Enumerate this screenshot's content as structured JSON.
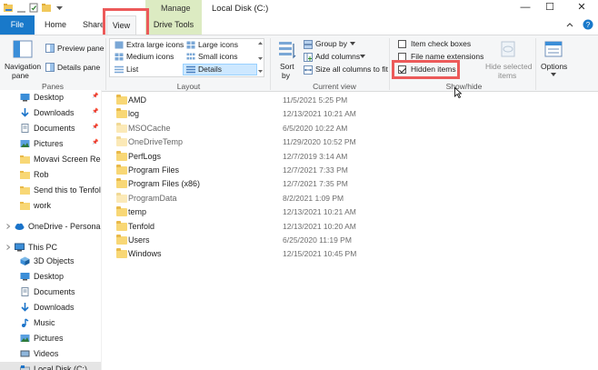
{
  "window": {
    "title": "Local Disk (C:)",
    "manage_tab": "Manage",
    "minimize": "—",
    "maximize": "☐",
    "close": "✕",
    "help": "?"
  },
  "tabs": {
    "file": "File",
    "home": "Home",
    "share": "Share",
    "view": "View",
    "drive_tools": "Drive Tools"
  },
  "ribbon": {
    "panes": {
      "navigation_pane": "Navigation",
      "navigation_pane_2": "pane",
      "preview_pane": "Preview pane",
      "details_pane": "Details pane",
      "group_label": "Panes"
    },
    "layout": {
      "extra_large_icons": "Extra large icons",
      "large_icons": "Large icons",
      "medium_icons": "Medium icons",
      "small_icons": "Small icons",
      "list": "List",
      "details": "Details",
      "group_label": "Layout"
    },
    "current_view": {
      "sort_by": "Sort",
      "sort_by_2": "by",
      "group_by": "Group by",
      "add_columns": "Add columns",
      "size_all_columns": "Size all columns to fit",
      "group_label": "Current view"
    },
    "show_hide": {
      "item_check_boxes": "Item check boxes",
      "file_name_extensions": "File name extensions",
      "hidden_items": "Hidden items",
      "hide_selected": "Hide selected",
      "hide_selected_2": "items",
      "group_label": "Show/hide",
      "item_check_boxes_checked": false,
      "file_name_extensions_checked": false,
      "hidden_items_checked": true
    },
    "options": {
      "label": "Options"
    }
  },
  "nav": {
    "items": [
      {
        "label": "Desktop",
        "pinned": true
      },
      {
        "label": "Downloads",
        "pinned": true
      },
      {
        "label": "Documents",
        "pinned": true
      },
      {
        "label": "Pictures",
        "pinned": true
      },
      {
        "label": "Movavi Screen Reco",
        "pinned": false
      },
      {
        "label": "Rob",
        "pinned": false
      },
      {
        "label": "Send this to Tenfold",
        "pinned": false
      },
      {
        "label": "work",
        "pinned": false
      },
      {
        "label": "OneDrive - Personal",
        "pinned": false
      },
      {
        "label": "This PC",
        "pinned": false
      },
      {
        "label": "3D Objects",
        "pinned": false
      },
      {
        "label": "Desktop",
        "pinned": false
      },
      {
        "label": "Documents",
        "pinned": false
      },
      {
        "label": "Downloads",
        "pinned": false
      },
      {
        "label": "Music",
        "pinned": false
      },
      {
        "label": "Pictures",
        "pinned": false
      },
      {
        "label": "Videos",
        "pinned": false
      },
      {
        "label": "Local Disk (C:)",
        "pinned": false
      }
    ],
    "pin_glyph": "📌"
  },
  "files": [
    {
      "name": "AMD",
      "modified": "11/5/2021 5:25 PM",
      "hidden": false
    },
    {
      "name": "log",
      "modified": "12/13/2021 10:21 AM",
      "hidden": false
    },
    {
      "name": "MSOCache",
      "modified": "6/5/2020 10:22 AM",
      "hidden": true
    },
    {
      "name": "OneDriveTemp",
      "modified": "11/29/2020 10:52 PM",
      "hidden": true
    },
    {
      "name": "PerfLogs",
      "modified": "12/7/2019 3:14 AM",
      "hidden": false
    },
    {
      "name": "Program Files",
      "modified": "12/7/2021 7:33 PM",
      "hidden": false
    },
    {
      "name": "Program Files (x86)",
      "modified": "12/7/2021 7:35 PM",
      "hidden": false
    },
    {
      "name": "ProgramData",
      "modified": "8/2/2021 1:09 PM",
      "hidden": true
    },
    {
      "name": "temp",
      "modified": "12/13/2021 10:21 AM",
      "hidden": false
    },
    {
      "name": "Tenfold",
      "modified": "12/13/2021 10:20 AM",
      "hidden": false
    },
    {
      "name": "Users",
      "modified": "6/25/2020 11:19 PM",
      "hidden": false
    },
    {
      "name": "Windows",
      "modified": "12/15/2021 10:45 PM",
      "hidden": false
    }
  ],
  "colors": {
    "file_tab": "#1979ca",
    "manage_tab": "#dcebc2",
    "highlight_box": "#ec5a5a",
    "details_selected": "#cde8ff",
    "folder": "#f8d775"
  }
}
